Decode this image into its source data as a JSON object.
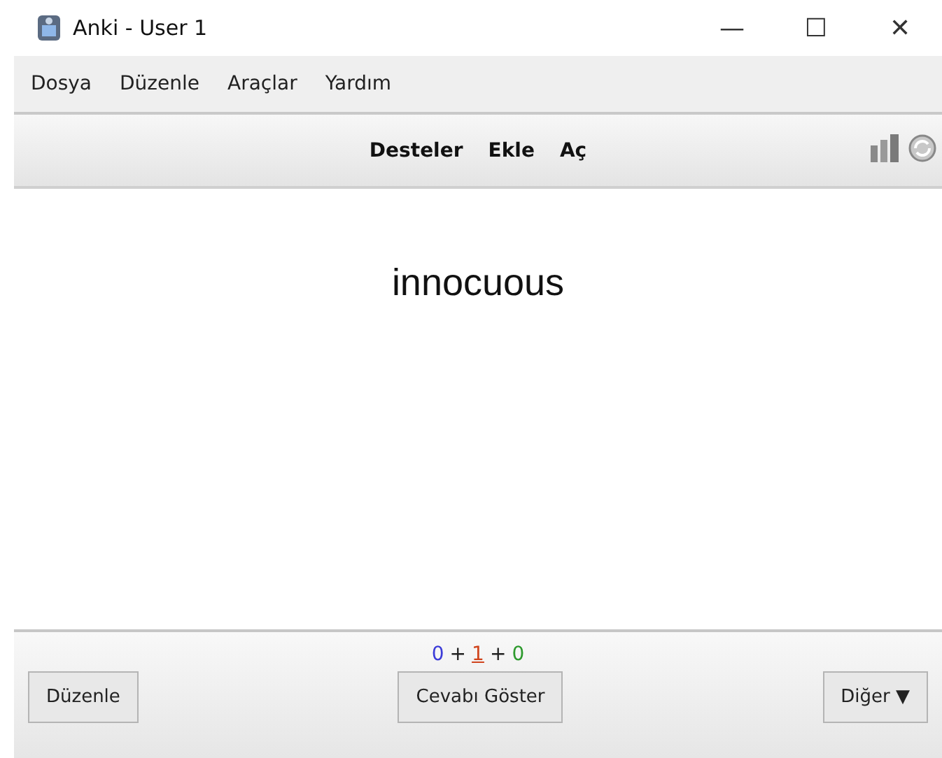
{
  "window": {
    "title": "Anki - User 1",
    "controls": [
      "—",
      "☐",
      "✕"
    ]
  },
  "menu": [
    "Dosya",
    "Düzenle",
    "Araçlar",
    "Yardım"
  ],
  "toolbar": {
    "links": [
      "Desteler",
      "Ekle",
      "Aç"
    ]
  },
  "card": {
    "question": "innocuous"
  },
  "counts": [
    {
      "value": "0",
      "color": "#3c3cd8",
      "underlined": false
    },
    {
      "value": "1",
      "color": "#d0441c",
      "underlined": true
    },
    {
      "value": "0",
      "color": "#2e9a2e",
      "underlined": false
    }
  ],
  "count_separators": [
    "+",
    "+"
  ],
  "buttons": {
    "edit": "Düzenle",
    "show_answer": "Cevabı Göster",
    "more": "Diğer ▼"
  }
}
